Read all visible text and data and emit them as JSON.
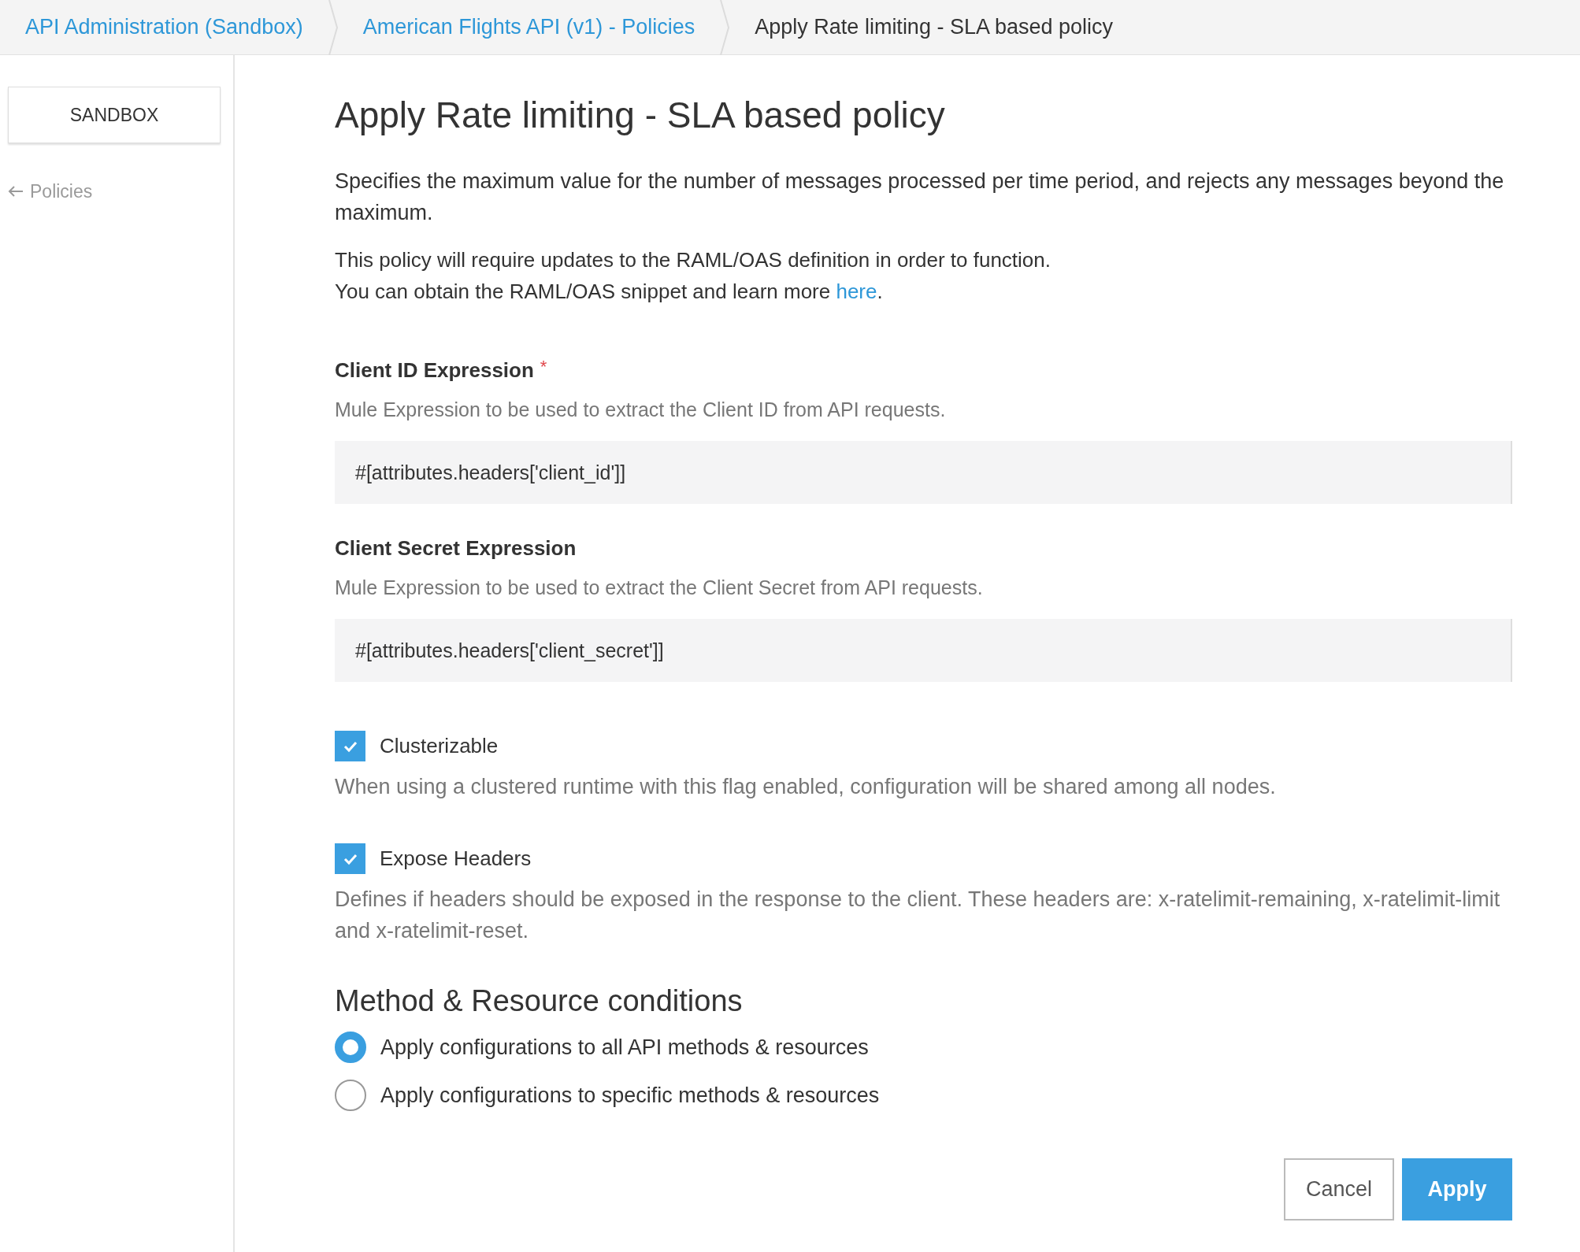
{
  "breadcrumbs": [
    {
      "label": "API Administration (Sandbox)",
      "kind": "link"
    },
    {
      "label": "American Flights API (v1) - Policies",
      "kind": "link"
    },
    {
      "label": "Apply Rate limiting - SLA based policy",
      "kind": "current"
    }
  ],
  "sidebar": {
    "environment_button": "SANDBOX",
    "back_link": "Policies"
  },
  "title": "Apply Rate limiting - SLA based policy",
  "description": [
    "Specifies the maximum value for the number of messages processed per time period, and rejects any messages beyond the maximum.",
    "This policy will require updates to the RAML/OAS definition in order to function."
  ],
  "snippet_note": {
    "text": "You can obtain the RAML/OAS snippet and learn more ",
    "link": "here",
    "after": "."
  },
  "required_marker": "*",
  "fields": [
    {
      "label": "Client ID Expression",
      "required": true,
      "description": "Mule Expression to be used to extract the Client ID from API requests.",
      "value": "#[attributes.headers['client_id']]"
    },
    {
      "label": "Client Secret Expression",
      "required": false,
      "description": "Mule Expression to be used to extract the Client Secret from API requests.",
      "value": "#[attributes.headers['client_secret']]"
    }
  ],
  "checkboxes": [
    {
      "label": "Clusterizable",
      "checked": true,
      "description": "When using a clustered runtime with this flag enabled, configuration will be shared among all nodes."
    },
    {
      "label": "Expose Headers",
      "checked": true,
      "description": "Defines if headers should be exposed in the response to the client. These headers are: x-ratelimit-remaining, x-ratelimit-limit and x-ratelimit-reset."
    }
  ],
  "conditions": {
    "heading": "Method & Resource conditions",
    "options": [
      {
        "label": "Apply configurations to all API methods & resources",
        "selected": true
      },
      {
        "label": "Apply configurations to specific methods & resources",
        "selected": false
      }
    ]
  },
  "buttons": [
    {
      "label": "Cancel",
      "kind": "secondary"
    },
    {
      "label": "Apply",
      "kind": "primary"
    }
  ]
}
